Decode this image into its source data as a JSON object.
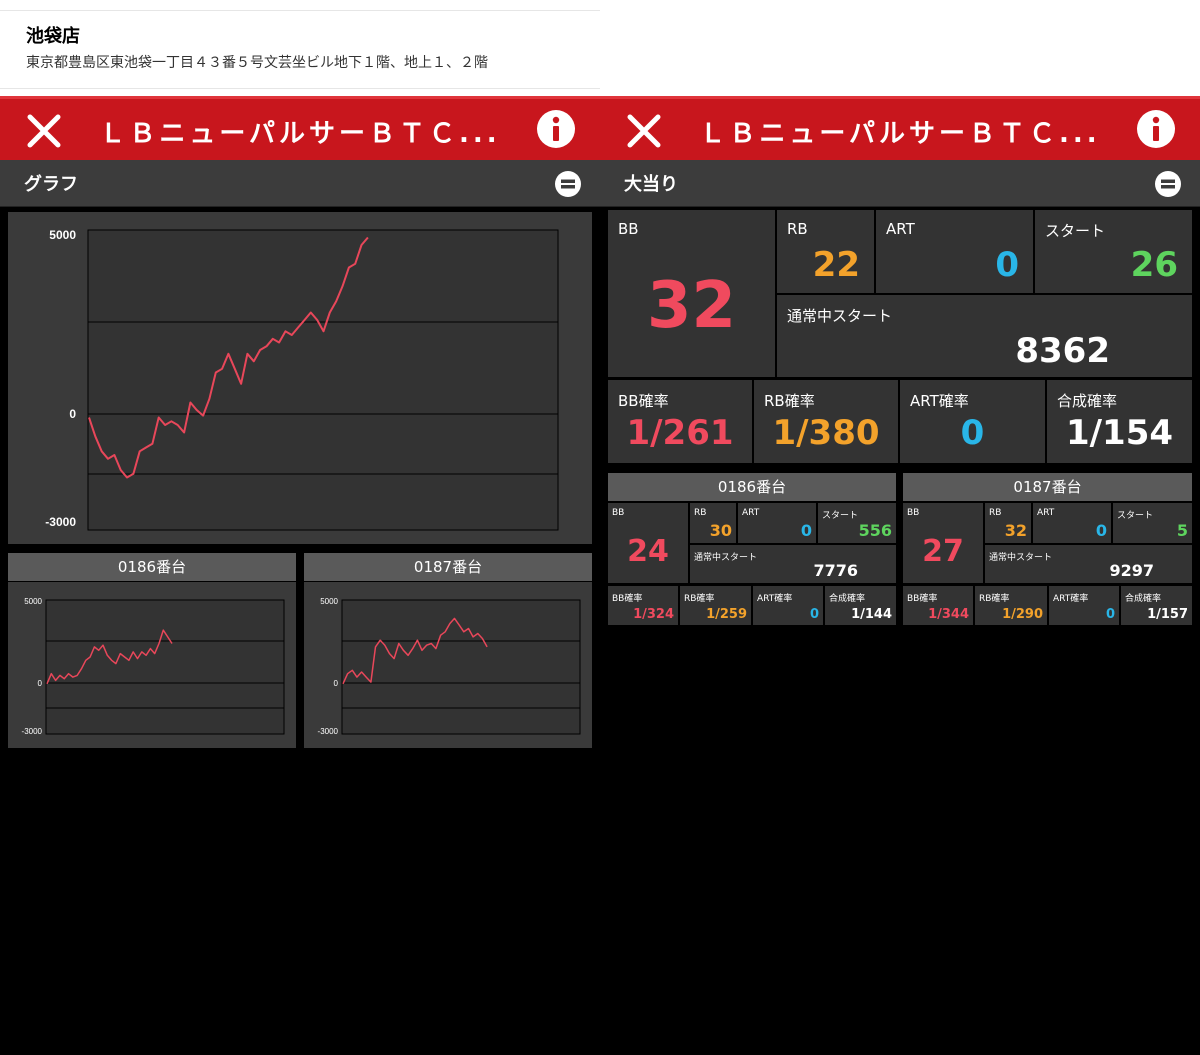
{
  "store": {
    "name": "池袋店",
    "address": "東京都豊島区東池袋一丁目４３番５号文芸坐ビル地下１階、地上１、２階"
  },
  "title": "ＬＢニューパルサーＢＴＣ...",
  "left": {
    "section_label": "グラフ",
    "main_chart_axis": {
      "max": "5000",
      "zero": "0",
      "min": "-3000"
    },
    "mini": [
      {
        "label": "0186番台",
        "axis": {
          "max": "5000",
          "zero": "0",
          "min": "-3000"
        }
      },
      {
        "label": "0187番台",
        "axis": {
          "max": "5000",
          "zero": "0",
          "min": "-3000"
        }
      }
    ]
  },
  "right": {
    "section_label": "大当り",
    "summary": {
      "bb_label": "BB",
      "bb": "32",
      "rb_label": "RB",
      "rb": "22",
      "art_label": "ART",
      "art": "0",
      "start_label": "スタート",
      "start": "26",
      "normal_start_label": "通常中スタート",
      "normal_start": "8362",
      "bb_prob_label": "BB確率",
      "bb_prob": "1/261",
      "rb_prob_label": "RB確率",
      "rb_prob": "1/380",
      "art_prob_label": "ART確率",
      "art_prob": "0",
      "combined_prob_label": "合成確率",
      "combined_prob": "1/154"
    },
    "machines": [
      {
        "label": "0186番台",
        "bb": "24",
        "rb": "30",
        "art": "0",
        "start": "556",
        "normal_start": "7776",
        "bb_prob": "1/324",
        "rb_prob": "1/259",
        "art_prob": "0",
        "combined_prob": "1/144"
      },
      {
        "label": "0187番台",
        "bb": "27",
        "rb": "32",
        "art": "0",
        "start": "5",
        "normal_start": "9297",
        "bb_prob": "1/344",
        "rb_prob": "1/290",
        "art_prob": "0",
        "combined_prob": "1/157"
      }
    ],
    "cell_labels": {
      "bb": "BB",
      "rb": "RB",
      "art": "ART",
      "start": "スタート",
      "normal_start": "通常中スタート",
      "bb_prob": "BB確率",
      "rb_prob": "RB確率",
      "art_prob": "ART確率",
      "combined_prob": "合成確率"
    }
  },
  "colors": {
    "titlebar": "#c8161d",
    "line": "#e8475a",
    "bb": "#f04a5e",
    "rb": "#f3a22b",
    "art": "#29b6e8",
    "start": "#5ed45e"
  },
  "chart_data": [
    {
      "type": "line",
      "title": "",
      "ylim": [
        -3000,
        5000
      ],
      "series": [
        {
          "values": [
            0,
            -500,
            -900,
            -1100,
            -1000,
            -1400,
            -1600,
            -1500,
            -900,
            -800,
            -700,
            0,
            -200,
            -100,
            -200,
            -400,
            400,
            200,
            50,
            500,
            1200,
            1300,
            1700,
            1300,
            900,
            1700,
            1500,
            1800,
            1900,
            2100,
            2000,
            2300,
            2200,
            2400,
            2600,
            2800,
            2600,
            2300,
            2800,
            3100,
            3500,
            4000,
            4100,
            4600,
            4800
          ]
        }
      ]
    },
    {
      "type": "line",
      "title": "0186番台",
      "ylim": [
        -3000,
        5000
      ],
      "series": [
        {
          "values": [
            0,
            600,
            200,
            500,
            300,
            600,
            400,
            500,
            900,
            1400,
            1600,
            2200,
            2000,
            2300,
            1700,
            1400,
            1200,
            1800,
            1600,
            1400,
            1900,
            1500,
            1900,
            1700,
            2100,
            1800,
            2400,
            3200,
            2800,
            2400
          ]
        }
      ]
    },
    {
      "type": "line",
      "title": "0187番台",
      "ylim": [
        -3000,
        5000
      ],
      "series": [
        {
          "values": [
            0,
            600,
            800,
            400,
            700,
            400,
            100,
            2200,
            2600,
            2300,
            1800,
            1500,
            2400,
            2000,
            1700,
            2100,
            2600,
            2000,
            2300,
            2400,
            2100,
            2900,
            3100,
            3600,
            3900,
            3500,
            3100,
            3300,
            2800,
            3000,
            2700,
            2200
          ]
        }
      ]
    }
  ]
}
